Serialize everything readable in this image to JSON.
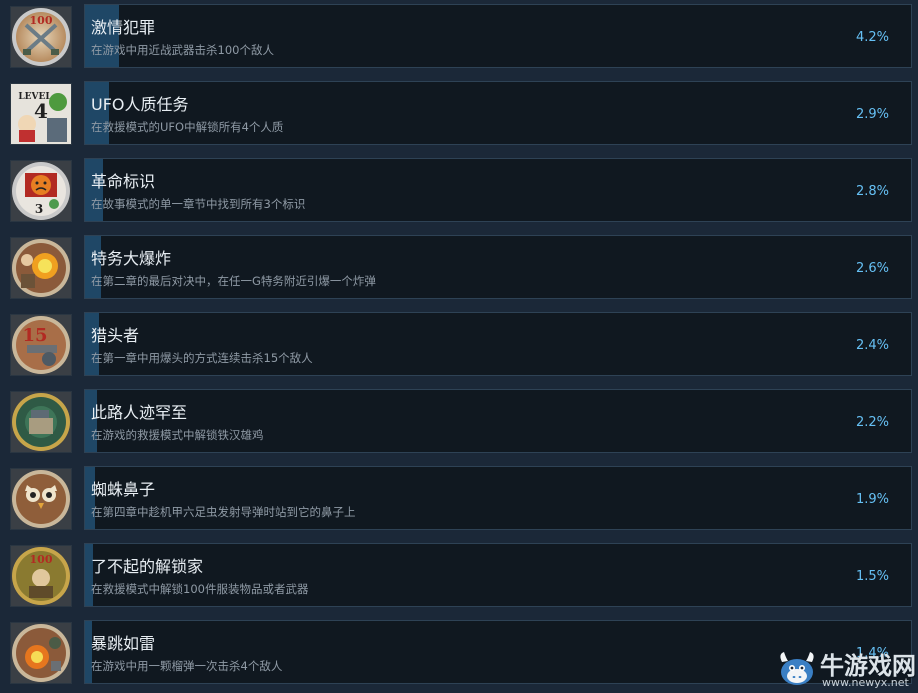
{
  "colors": {
    "background": "#1b2838",
    "panel": "#101820",
    "progress": "#1f4766",
    "title": "#e8eef3",
    "description": "#8f9aa5",
    "percent": "#66c0f4"
  },
  "achievements": [
    {
      "icon": "crossed-knives-icon",
      "title": "激情犯罪",
      "description": "在游戏中用近战武器击杀100个敌人",
      "percent": "4.2%",
      "progress": 0.042
    },
    {
      "icon": "level-4-ufo-icon",
      "title": "UFO人质任务",
      "description": "在救援模式的UFO中解锁所有4个人质",
      "percent": "2.9%",
      "progress": 0.029
    },
    {
      "icon": "emblem-3-icon",
      "title": "革命标识",
      "description": "在故事模式的单一章节中找到所有3个标识",
      "percent": "2.8%",
      "progress": 0.028
    },
    {
      "icon": "explosion-icon",
      "title": "特务大爆炸",
      "description": "在第二章的最后对决中，在任一G特务附近引爆一个炸弹",
      "percent": "2.6%",
      "progress": 0.026
    },
    {
      "icon": "headshot-15-icon",
      "title": "猎头者",
      "description": "在第一章中用爆头的方式连续击杀15个敌人",
      "percent": "2.4%",
      "progress": 0.024
    },
    {
      "icon": "iron-rooster-icon",
      "title": "此路人迹罕至",
      "description": "在游戏的救援模式中解锁铁汉雄鸡",
      "percent": "2.2%",
      "progress": 0.022
    },
    {
      "icon": "owl-icon",
      "title": "蜘蛛鼻子",
      "description": "在第四章中趁机甲六足虫发射导弹时站到它的鼻子上",
      "percent": "1.9%",
      "progress": 0.019
    },
    {
      "icon": "unlock-100-icon",
      "title": "了不起的解锁家",
      "description": "在救援模式中解锁100件服装物品或者武器",
      "percent": "1.5%",
      "progress": 0.015
    },
    {
      "icon": "grenade-blast-icon",
      "title": "暴跳如雷",
      "description": "在游戏中用一颗榴弹一次击杀4个敌人",
      "percent": "1.4%",
      "progress": 0.014
    }
  ],
  "watermark": {
    "title": "牛游戏网",
    "url": "www.newyx.net"
  }
}
